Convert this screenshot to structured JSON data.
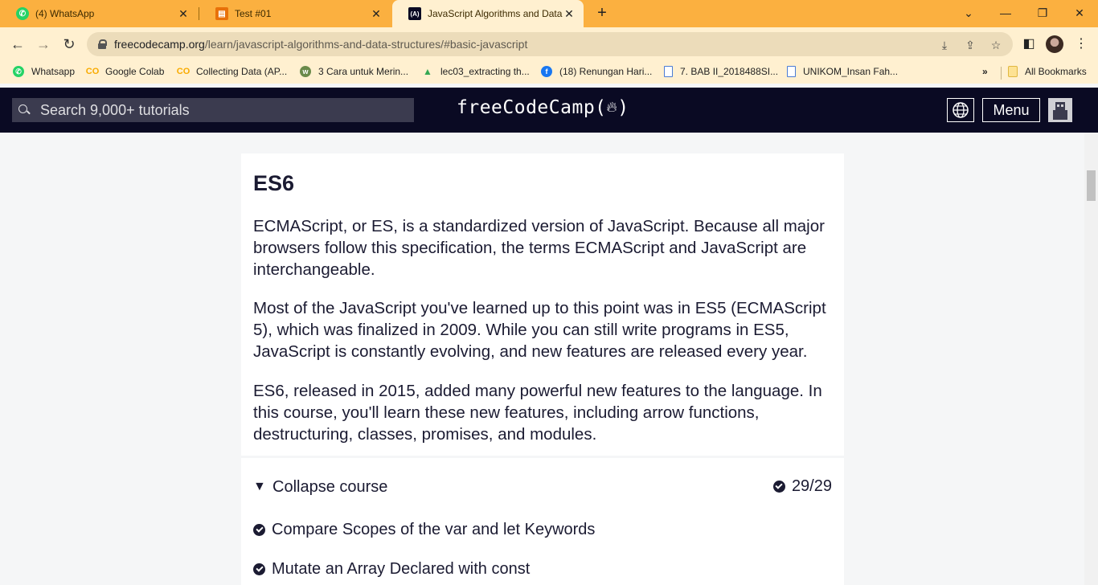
{
  "browser": {
    "tabs": [
      {
        "title": "(4) WhatsApp",
        "icon": "whatsapp-icon",
        "color": "#25d366"
      },
      {
        "title": "Test #01",
        "icon": "form-icon",
        "color": "#e8710a"
      },
      {
        "title": "JavaScript Algorithms and Data S",
        "icon": "fcc-icon",
        "color": "#0a0a23"
      }
    ],
    "url_host": "freecodecamp.org",
    "url_path": "/learn/javascript-algorithms-and-data-structures/#basic-javascript",
    "bookmarks": [
      {
        "label": "Whatsapp",
        "color": "#25d366"
      },
      {
        "label": "Google Colab",
        "color": "#f9ab00"
      },
      {
        "label": "Collecting Data (AP...",
        "color": "#f9ab00"
      },
      {
        "label": "3 Cara untuk Merin...",
        "color": "#6a8a4a"
      },
      {
        "label": "lec03_extracting th...",
        "color": "#34a853"
      },
      {
        "label": "(18) Renungan Hari...",
        "color": "#1877f2"
      },
      {
        "label": "7. BAB II_2018488SI...",
        "color": "#4a7bd4"
      },
      {
        "label": "UNIKOM_Insan Fah...",
        "color": "#4a7bd4"
      }
    ],
    "more_bookmarks": "»",
    "all_bookmarks": "All Bookmarks",
    "accent": "#fbb040"
  },
  "fcc": {
    "search_placeholder": "Search 9,000+ tutorials",
    "logo": "freeCodeCamp(🔥)",
    "logo_text": "freeCodeCamp",
    "menu_label": "Menu"
  },
  "content": {
    "heading": "ES6",
    "paragraphs": [
      "ECMAScript, or ES, is a standardized version of JavaScript. Because all major browsers follow this specification, the terms ECMAScript and JavaScript are interchangeable.",
      "Most of the JavaScript you've learned up to this point was in ES5 (ECMAScript 5), which was finalized in 2009. While you can still write programs in ES5, JavaScript is constantly evolving, and new features are released every year.",
      "ES6, released in 2015, added many powerful new features to the language. In this course, you'll learn these new features, including arrow functions, destructuring, classes, promises, and modules."
    ],
    "collapse_label": "Collapse course",
    "progress": "29/29",
    "lessons": [
      "Compare Scopes of the var and let Keywords",
      "Mutate an Array Declared with const"
    ]
  }
}
